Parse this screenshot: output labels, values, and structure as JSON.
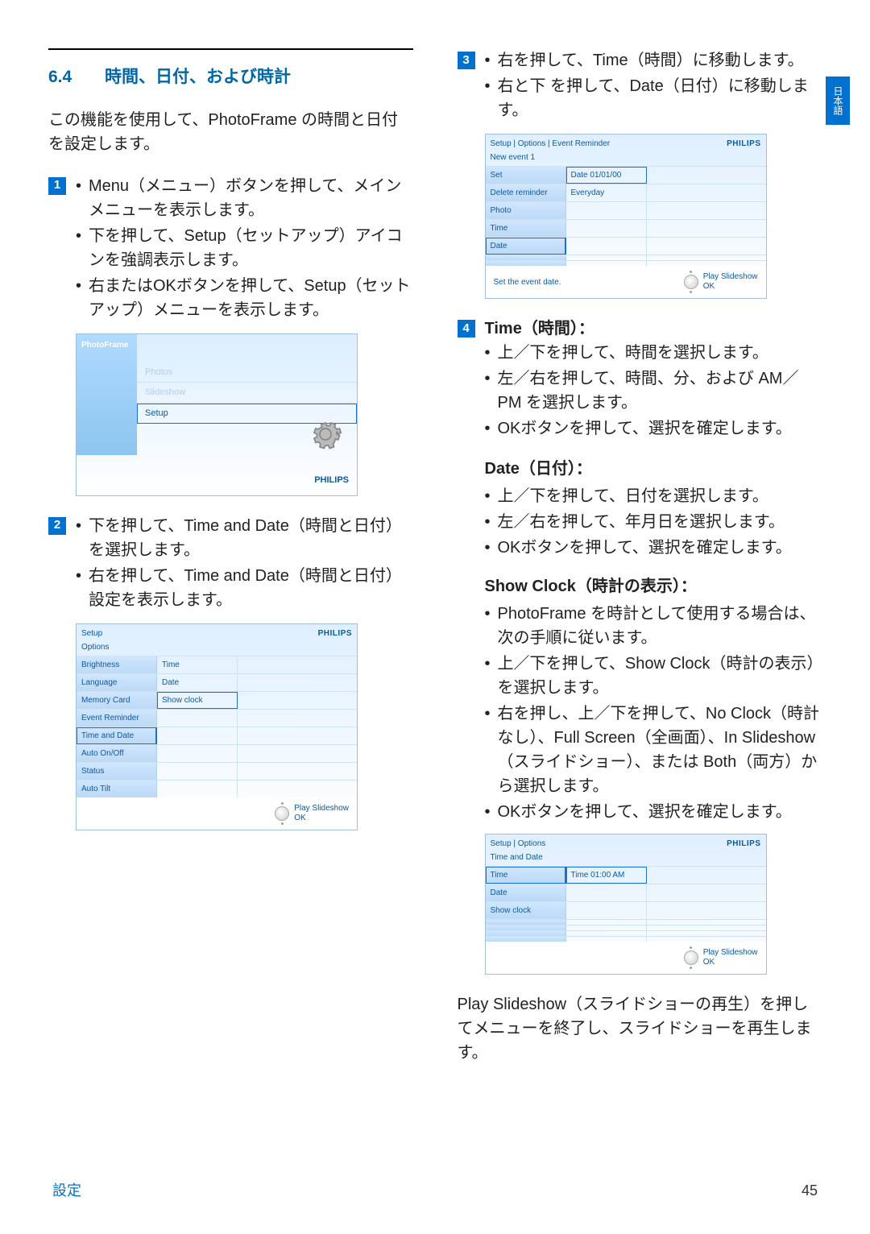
{
  "section": {
    "number": "6.4",
    "title": "時間、日付、および時計"
  },
  "intro": "この機能を使用して、PhotoFrame の時間と日付を設定します。",
  "steps": {
    "s1": {
      "a_full": "Menu（メニュー）ボタンを押して、メインメニューを表示します。",
      "b_full": "下を押して、Setup（セットアップ）アイコンを強調表示します。",
      "c_full": "右またはOKボタンを押して、Setup（セットアップ）メニューを表示します。"
    },
    "s2": {
      "a_full": "下を押して、Time and Date（時間と日付）を選択します。",
      "b_full": "右を押して、Time and Date（時間と日付）設定を表示します。"
    },
    "s3": {
      "a_full": "右を押して、Time（時間）に移動します。",
      "b_full": "右と下 を押して、Date（日付）に移動します。"
    },
    "s4": {
      "head_time": "Time（時間）：",
      "t1": "上／下を押して、時間を選択します。",
      "t2": "左／右を押して、時間、分、および AM／PM を選択します。",
      "t3": "OKボタンを押して、選択を確定します。",
      "head_date": "Date（日付）：",
      "d1": "上／下を押して、日付を選択します。",
      "d2": "左／右を押して、年月日を選択します。",
      "d3": "OKボタンを押して、選択を確定します。",
      "head_clock": "Show Clock（時計の表示）：",
      "c1": "PhotoFrame を時計として使用する場合は、次の手順に従います。",
      "c2": "上／下を押して、Show Clock（時計の表示）を選択します。",
      "c3": "右を押し、上／下を押して、No Clock（時計なし）、Full Screen（全画面）、In Slideshow（スライドショー）、または Both（両方）から選択します。",
      "c4": "OKボタンを押して、選択を確定します。"
    }
  },
  "closing_full": "Play Slideshow（スライドショーの再生）を押してメニューを終了し、スライドショーを再生します。",
  "brand": "PHILIPS",
  "shot1": {
    "side": "PhotoFrame",
    "items": [
      "Photos",
      "Slideshow",
      "Setup"
    ]
  },
  "shot2": {
    "crumb": "Setup",
    "sub": "Options",
    "left": [
      "Brightness",
      "Language",
      "Memory Card",
      "Event Reminder",
      "Time and Date",
      "Auto On/Off",
      "Status",
      "Auto Tilt"
    ],
    "mid": [
      "Time",
      "Date",
      "Show clock"
    ],
    "hint": "",
    "play": "Play Slideshow",
    "ok": "OK"
  },
  "shot3": {
    "crumb": "Setup | Options | Event Reminder",
    "sub": "New event 1",
    "left": [
      "Set",
      "Delete reminder",
      "Photo",
      "Time",
      "Date"
    ],
    "mid": [
      "Date   01/01/00",
      "Everyday"
    ],
    "hint": "Set the event date.",
    "play": "Play Slideshow",
    "ok": "OK"
  },
  "shot4": {
    "crumb": "Setup | Options",
    "sub": "Time and Date",
    "left": [
      "Time",
      "Date",
      "Show clock"
    ],
    "mid": [
      "Time   01:00 AM"
    ],
    "hint": "",
    "play": "Play Slideshow",
    "ok": "OK"
  },
  "side_tab": "日本語",
  "footer": {
    "left": "設定",
    "right": "45"
  }
}
